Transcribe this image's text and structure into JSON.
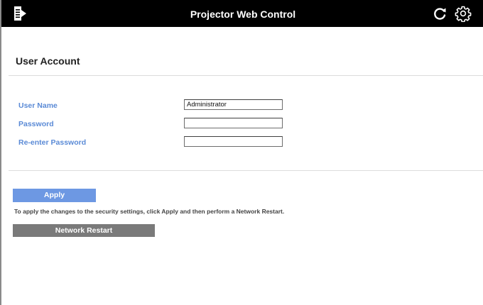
{
  "header": {
    "title": "Projector Web Control",
    "menu_icon": "menu-document-icon",
    "refresh_icon": "refresh-icon",
    "settings_icon": "gear-icon",
    "background_color": "#000000"
  },
  "section": {
    "title": "User Account"
  },
  "form": {
    "fields": [
      {
        "label": "User Name",
        "value": "Administrator",
        "placeholder": ""
      },
      {
        "label": "Password",
        "value": "",
        "placeholder": ""
      },
      {
        "label": "Re-enter Password",
        "value": "",
        "placeholder": ""
      }
    ],
    "label_color": "#5a8ad6"
  },
  "actions": {
    "apply_label": "Apply",
    "apply_color": "#6d98e3",
    "note": "To apply the changes to the security settings, click Apply and then perform a Network Restart.",
    "restart_label": "Network Restart",
    "restart_color": "#7a7a7a"
  }
}
